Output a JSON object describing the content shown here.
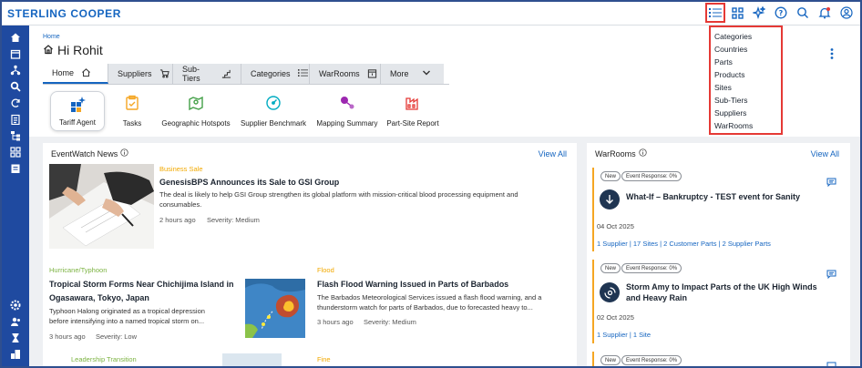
{
  "app": {
    "brand": "STERLING COOPER"
  },
  "topbar": {
    "icons": [
      "list-icon",
      "grid-icon",
      "sparkle-icon",
      "help-icon",
      "search-icon",
      "bell-icon",
      "user-icon"
    ]
  },
  "dropdown": {
    "items": [
      "Categories",
      "Countries",
      "Parts",
      "Products",
      "Sites",
      "Sub-Tiers",
      "Suppliers",
      "WarRooms"
    ]
  },
  "page": {
    "breadcrumb": "Home",
    "greeting": "Hi Rohit"
  },
  "tabs": [
    {
      "label": "Home"
    },
    {
      "label": "Suppliers"
    },
    {
      "label": "Sub-Tiers"
    },
    {
      "label": "Categories"
    },
    {
      "label": "WarRooms"
    },
    {
      "label": "More"
    }
  ],
  "quick_actions": [
    {
      "label": "Tariff Agent"
    },
    {
      "label": "Tasks"
    },
    {
      "label": "Geographic Hotspots"
    },
    {
      "label": "Supplier Benchmark"
    },
    {
      "label": "Mapping Summary"
    },
    {
      "label": "Part-Site Report"
    }
  ],
  "news": {
    "title": "EventWatch News",
    "view_all": "View All",
    "items": [
      {
        "category": "Business Sale",
        "headline": "GenesisBPS Announces its Sale to GSI Group",
        "desc_line1": "The deal is likely to help GSI Group strengthen its global platform with mission-critical blood processing equipment and",
        "desc_line2": "consumables.",
        "time": "2 hours ago",
        "severity": "Severity: Medium"
      },
      {
        "category": "Hurricane/Typhoon",
        "headline_line1": "Tropical Storm Forms Near Chichijima Island in",
        "headline_line2": "Ogasawara, Tokyo, Japan",
        "desc_line1": "Typhoon Halong originated as a tropical depression",
        "desc_line2": "before intensifying into a named tropical storm on...",
        "time": "3 hours ago",
        "severity": "Severity: Low"
      },
      {
        "category": "Flood",
        "headline": "Flash Flood Warning Issued in Parts of Barbados",
        "desc_line1": "The Barbados Meteorological Services issued a flash flood warning, and a",
        "desc_line2": "thunderstorm watch for parts of Barbados, due to forecasted heavy to...",
        "time": "3 hours ago",
        "severity": "Severity: Medium"
      },
      {
        "category": "Leadership Transition"
      },
      {
        "category": "Fine"
      }
    ]
  },
  "warrooms": {
    "title": "WarRooms",
    "view_all": "View All",
    "cards": [
      {
        "badge_new": "New",
        "badge_response": "Event Response: 0%",
        "title": "What-If – Bankruptcy - TEST event for Sanity",
        "date": "04 Oct 2025",
        "links": "1 Supplier | 17 Sites | 2 Customer Parts | 2 Supplier Parts"
      },
      {
        "badge_new": "New",
        "badge_response": "Event Response: 0%",
        "title_line1": "Storm Amy to Impact Parts of the UK High Winds",
        "title_line2": "and Heavy Rain",
        "date": "02 Oct 2025",
        "links": "1 Supplier | 1 Site"
      },
      {
        "badge_new": "New",
        "badge_response": "Event Response: 0%"
      }
    ]
  },
  "colors": {
    "brand_blue": "#1565c0",
    "rail_blue": "#1f4aa0",
    "accent_orange": "#f5a623",
    "highlight_red": "#e53935",
    "business_yellow": "#f2a900",
    "hurricane_green": "#7cb342"
  }
}
